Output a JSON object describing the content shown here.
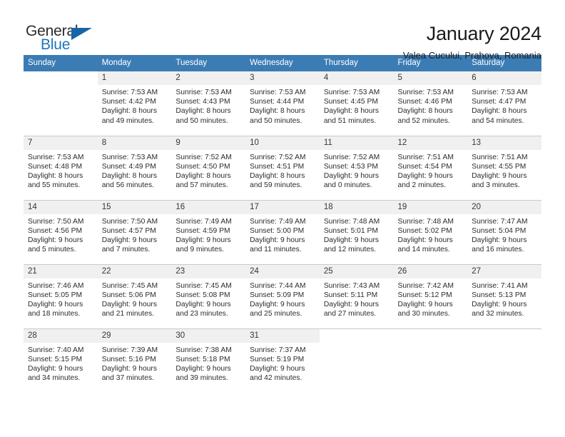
{
  "brand": {
    "logo_general": "General",
    "logo_blue": "Blue",
    "logo_icon": "triangle-icon",
    "accent_color": "#1d76bd",
    "header_color": "#3c7cb4"
  },
  "header": {
    "title": "January 2024",
    "subtitle": "Valea Cucului, Prahova, Romania"
  },
  "calendar": {
    "weekday_headers": [
      "Sunday",
      "Monday",
      "Tuesday",
      "Wednesday",
      "Thursday",
      "Friday",
      "Saturday"
    ],
    "labels": {
      "sunrise": "Sunrise:",
      "sunset": "Sunset:",
      "daylight": "Daylight:"
    },
    "weeks": [
      [
        {
          "day": "",
          "blank": true
        },
        {
          "day": "1",
          "sunrise": "Sunrise: 7:53 AM",
          "sunset": "Sunset: 4:42 PM",
          "daylight_1": "Daylight: 8 hours",
          "daylight_2": "and 49 minutes."
        },
        {
          "day": "2",
          "sunrise": "Sunrise: 7:53 AM",
          "sunset": "Sunset: 4:43 PM",
          "daylight_1": "Daylight: 8 hours",
          "daylight_2": "and 50 minutes."
        },
        {
          "day": "3",
          "sunrise": "Sunrise: 7:53 AM",
          "sunset": "Sunset: 4:44 PM",
          "daylight_1": "Daylight: 8 hours",
          "daylight_2": "and 50 minutes."
        },
        {
          "day": "4",
          "sunrise": "Sunrise: 7:53 AM",
          "sunset": "Sunset: 4:45 PM",
          "daylight_1": "Daylight: 8 hours",
          "daylight_2": "and 51 minutes."
        },
        {
          "day": "5",
          "sunrise": "Sunrise: 7:53 AM",
          "sunset": "Sunset: 4:46 PM",
          "daylight_1": "Daylight: 8 hours",
          "daylight_2": "and 52 minutes."
        },
        {
          "day": "6",
          "sunrise": "Sunrise: 7:53 AM",
          "sunset": "Sunset: 4:47 PM",
          "daylight_1": "Daylight: 8 hours",
          "daylight_2": "and 54 minutes."
        }
      ],
      [
        {
          "day": "7",
          "sunrise": "Sunrise: 7:53 AM",
          "sunset": "Sunset: 4:48 PM",
          "daylight_1": "Daylight: 8 hours",
          "daylight_2": "and 55 minutes."
        },
        {
          "day": "8",
          "sunrise": "Sunrise: 7:53 AM",
          "sunset": "Sunset: 4:49 PM",
          "daylight_1": "Daylight: 8 hours",
          "daylight_2": "and 56 minutes."
        },
        {
          "day": "9",
          "sunrise": "Sunrise: 7:52 AM",
          "sunset": "Sunset: 4:50 PM",
          "daylight_1": "Daylight: 8 hours",
          "daylight_2": "and 57 minutes."
        },
        {
          "day": "10",
          "sunrise": "Sunrise: 7:52 AM",
          "sunset": "Sunset: 4:51 PM",
          "daylight_1": "Daylight: 8 hours",
          "daylight_2": "and 59 minutes."
        },
        {
          "day": "11",
          "sunrise": "Sunrise: 7:52 AM",
          "sunset": "Sunset: 4:53 PM",
          "daylight_1": "Daylight: 9 hours",
          "daylight_2": "and 0 minutes."
        },
        {
          "day": "12",
          "sunrise": "Sunrise: 7:51 AM",
          "sunset": "Sunset: 4:54 PM",
          "daylight_1": "Daylight: 9 hours",
          "daylight_2": "and 2 minutes."
        },
        {
          "day": "13",
          "sunrise": "Sunrise: 7:51 AM",
          "sunset": "Sunset: 4:55 PM",
          "daylight_1": "Daylight: 9 hours",
          "daylight_2": "and 3 minutes."
        }
      ],
      [
        {
          "day": "14",
          "sunrise": "Sunrise: 7:50 AM",
          "sunset": "Sunset: 4:56 PM",
          "daylight_1": "Daylight: 9 hours",
          "daylight_2": "and 5 minutes."
        },
        {
          "day": "15",
          "sunrise": "Sunrise: 7:50 AM",
          "sunset": "Sunset: 4:57 PM",
          "daylight_1": "Daylight: 9 hours",
          "daylight_2": "and 7 minutes."
        },
        {
          "day": "16",
          "sunrise": "Sunrise: 7:49 AM",
          "sunset": "Sunset: 4:59 PM",
          "daylight_1": "Daylight: 9 hours",
          "daylight_2": "and 9 minutes."
        },
        {
          "day": "17",
          "sunrise": "Sunrise: 7:49 AM",
          "sunset": "Sunset: 5:00 PM",
          "daylight_1": "Daylight: 9 hours",
          "daylight_2": "and 11 minutes."
        },
        {
          "day": "18",
          "sunrise": "Sunrise: 7:48 AM",
          "sunset": "Sunset: 5:01 PM",
          "daylight_1": "Daylight: 9 hours",
          "daylight_2": "and 12 minutes."
        },
        {
          "day": "19",
          "sunrise": "Sunrise: 7:48 AM",
          "sunset": "Sunset: 5:02 PM",
          "daylight_1": "Daylight: 9 hours",
          "daylight_2": "and 14 minutes."
        },
        {
          "day": "20",
          "sunrise": "Sunrise: 7:47 AM",
          "sunset": "Sunset: 5:04 PM",
          "daylight_1": "Daylight: 9 hours",
          "daylight_2": "and 16 minutes."
        }
      ],
      [
        {
          "day": "21",
          "sunrise": "Sunrise: 7:46 AM",
          "sunset": "Sunset: 5:05 PM",
          "daylight_1": "Daylight: 9 hours",
          "daylight_2": "and 18 minutes."
        },
        {
          "day": "22",
          "sunrise": "Sunrise: 7:45 AM",
          "sunset": "Sunset: 5:06 PM",
          "daylight_1": "Daylight: 9 hours",
          "daylight_2": "and 21 minutes."
        },
        {
          "day": "23",
          "sunrise": "Sunrise: 7:45 AM",
          "sunset": "Sunset: 5:08 PM",
          "daylight_1": "Daylight: 9 hours",
          "daylight_2": "and 23 minutes."
        },
        {
          "day": "24",
          "sunrise": "Sunrise: 7:44 AM",
          "sunset": "Sunset: 5:09 PM",
          "daylight_1": "Daylight: 9 hours",
          "daylight_2": "and 25 minutes."
        },
        {
          "day": "25",
          "sunrise": "Sunrise: 7:43 AM",
          "sunset": "Sunset: 5:11 PM",
          "daylight_1": "Daylight: 9 hours",
          "daylight_2": "and 27 minutes."
        },
        {
          "day": "26",
          "sunrise": "Sunrise: 7:42 AM",
          "sunset": "Sunset: 5:12 PM",
          "daylight_1": "Daylight: 9 hours",
          "daylight_2": "and 30 minutes."
        },
        {
          "day": "27",
          "sunrise": "Sunrise: 7:41 AM",
          "sunset": "Sunset: 5:13 PM",
          "daylight_1": "Daylight: 9 hours",
          "daylight_2": "and 32 minutes."
        }
      ],
      [
        {
          "day": "28",
          "sunrise": "Sunrise: 7:40 AM",
          "sunset": "Sunset: 5:15 PM",
          "daylight_1": "Daylight: 9 hours",
          "daylight_2": "and 34 minutes."
        },
        {
          "day": "29",
          "sunrise": "Sunrise: 7:39 AM",
          "sunset": "Sunset: 5:16 PM",
          "daylight_1": "Daylight: 9 hours",
          "daylight_2": "and 37 minutes."
        },
        {
          "day": "30",
          "sunrise": "Sunrise: 7:38 AM",
          "sunset": "Sunset: 5:18 PM",
          "daylight_1": "Daylight: 9 hours",
          "daylight_2": "and 39 minutes."
        },
        {
          "day": "31",
          "sunrise": "Sunrise: 7:37 AM",
          "sunset": "Sunset: 5:19 PM",
          "daylight_1": "Daylight: 9 hours",
          "daylight_2": "and 42 minutes."
        },
        {
          "day": "",
          "blank": true
        },
        {
          "day": "",
          "blank": true
        },
        {
          "day": "",
          "blank": true
        }
      ]
    ]
  }
}
